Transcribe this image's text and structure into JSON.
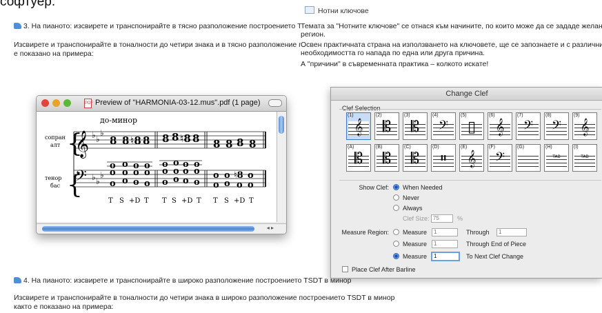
{
  "page_top_text": "софтуер.",
  "task3": {
    "heading": "3. На пианото: изсвирете и транспонирайте в тясно разположение построението TSDT в минор",
    "desc_line1": "Изсвирете и транспонирайте в тоналности до четири знака и в тясно разположение построението TS",
    "desc_line2": "е показано на примера:"
  },
  "right_panel": {
    "header": "Нотни ключове",
    "p1_line1": "Темата за \"Нотните ключове\" се отнася към начините, по които може да се зададе желан клю",
    "p1_line2": "регион.",
    "p2_line1": "Освен практичната страна на използването на ключовете, ще се запознаете и с различните на",
    "p2_line2": "необходимостта го напада по една или друга причина.",
    "p3": "А \"причини\" в съвременната практика – колкото искате!"
  },
  "preview_window": {
    "title": "Preview of \"HARMONIA-03-12.mus\".pdf (1 page)",
    "colors": {
      "close": "#e0443a",
      "minimize": "#e6a52a",
      "zoom": "#5cb83a"
    },
    "score": {
      "key_label": "до-минор",
      "staff_label_1": "сопран",
      "staff_label_2": "алт",
      "staff_label_3": "тенор",
      "staff_label_4": "бас",
      "functions": [
        "T",
        "S",
        "+D",
        "T",
        "T",
        "S",
        "+D",
        "T",
        "T",
        "S",
        "+D",
        "T"
      ]
    },
    "scroll_arrows": "◂ ▸"
  },
  "change_clef_dialog": {
    "title": "Change Clef",
    "group_label": "Clef Selection",
    "clef_row1": [
      {
        "code": "(1)",
        "glyph": "𝄞",
        "selected": true
      },
      {
        "code": "(2)",
        "glyph": "𝄡",
        "selected": false
      },
      {
        "code": "(3)",
        "glyph": "𝄡",
        "selected": false
      },
      {
        "code": "(4)",
        "glyph": "𝄢",
        "selected": false
      },
      {
        "code": "(5)",
        "glyph": "▯",
        "selected": false
      },
      {
        "code": "(6)",
        "glyph": "𝄞",
        "selected": false
      },
      {
        "code": "(7)",
        "glyph": "𝄢",
        "selected": false
      },
      {
        "code": "(8)",
        "glyph": "𝄢",
        "selected": false
      },
      {
        "code": "(9)",
        "glyph": "𝄞",
        "selected": false
      }
    ],
    "clef_row2": [
      {
        "code": "(A)",
        "glyph": "𝄡",
        "selected": false
      },
      {
        "code": "(B)",
        "glyph": "𝄡",
        "selected": false
      },
      {
        "code": "(C)",
        "glyph": "𝄡",
        "selected": false
      },
      {
        "code": "(D)",
        "glyph": "𝄥",
        "selected": false
      },
      {
        "code": "(E)",
        "glyph": "𝄞",
        "selected": false
      },
      {
        "code": "(F)",
        "glyph": "𝄢",
        "selected": false
      },
      {
        "code": "(G)",
        "glyph": "",
        "selected": false
      },
      {
        "code": "(H)",
        "glyph": "TAB",
        "selected": false
      },
      {
        "code": "(I)",
        "glyph": "TAB",
        "selected": false
      }
    ],
    "show_clef_label": "Show Clef:",
    "show_clef_options": [
      "When Needed",
      "Never",
      "Always"
    ],
    "show_clef_selected": "When Needed",
    "clef_size_label": "Clef Size:",
    "clef_size_value": "75",
    "clef_size_unit": "%",
    "measure_region_label": "Measure Region:",
    "measure_option": "Measure",
    "measure_value_1": "1",
    "through_label": "Through",
    "through_value": "1",
    "measure_value_2": "1",
    "through_end_label": "Through End of Piece",
    "measure_value_3": "1",
    "next_change_label": "To Next Clef Change",
    "place_after_barline_label": "Place Clef After Barline"
  },
  "task4": {
    "heading": "4. На пианото: изсвирете и транспонирайте в широко разположение построението TSDT в минор",
    "desc_line1": "Изсвирете и транспонирайте в тоналности до четири знака в широко разположение построението TSDT в минор",
    "desc_line2": "както е показано на примера:"
  }
}
